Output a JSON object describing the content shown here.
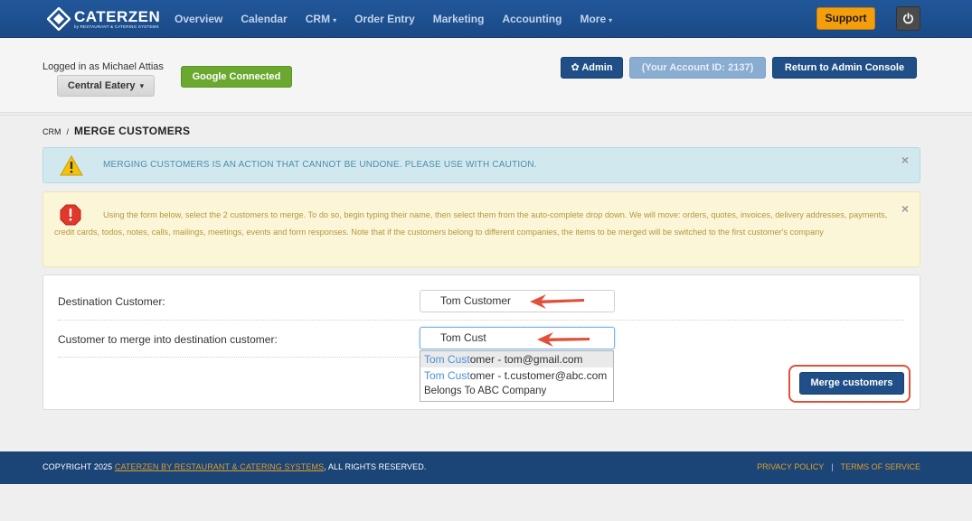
{
  "brand": {
    "name": "CATERZEN",
    "sub": "by RESTAURANT & CATERING SYSTEMS"
  },
  "nav": {
    "items": [
      {
        "label": "Overview"
      },
      {
        "label": "Calendar"
      },
      {
        "label": "CRM",
        "caret": "▾"
      },
      {
        "label": "Order Entry"
      },
      {
        "label": "Marketing"
      },
      {
        "label": "Accounting"
      },
      {
        "label": "More",
        "caret": "▾"
      }
    ],
    "support_label": "Support"
  },
  "account": {
    "logged_in": "Logged in as Michael Attias",
    "eatery_label": "Central Eatery",
    "eatery_caret": "▾",
    "google_label": "Google Connected",
    "admin_label": "Admin",
    "account_id_label": "(Your Account ID: 2137)",
    "return_label": "Return to Admin Console"
  },
  "breadcrumb": {
    "crm": "CRM",
    "sep": "/",
    "title": "MERGE CUSTOMERS"
  },
  "alerts": {
    "info": "MERGING CUSTOMERS IS AN ACTION THAT CANNOT BE UNDONE. PLEASE USE WITH CAUTION.",
    "warn": "Using the form below, select the 2 customers to merge. To do so, begin typing their name, then select them from the auto-complete drop down. We will move: orders, quotes, invoices, delivery addresses, payments, credit cards, todos, notes, calls, mailings, meetings, events and form responses. Note that if the customers belong to different companies, the items to be merged will be switched to the first customer's company",
    "close": "×"
  },
  "form": {
    "destination_label": "Destination Customer:",
    "destination_value": "Tom Customer",
    "merge_label": "Customer to merge into destination customer:",
    "merge_value": "Tom Cust",
    "suggestions": [
      {
        "match": "Tom Cust",
        "rest": "omer - tom@gmail.com"
      },
      {
        "match": "Tom Cust",
        "rest": "omer - t.customer@abc.com",
        "sub": "Belongs To ABC Company"
      }
    ],
    "merge_button": "Merge customers"
  },
  "footer": {
    "copyright": "COPYRIGHT 2025 ",
    "company_link": "CATERZEN BY RESTAURANT & CATERING SYSTEMS",
    "rights": ", ALL RIGHTS RESERVED.",
    "privacy": "PRIVACY POLICY",
    "sep": "|",
    "terms": "TERMS OF SERVICE"
  },
  "colors": {
    "nav_bg": "#1a4a86",
    "primary_button": "#1f4f86",
    "support_button": "#f59e0b",
    "google_button": "#6aa82f",
    "annotation_red": "#e0503a",
    "footer_link": "#e0a02a"
  }
}
